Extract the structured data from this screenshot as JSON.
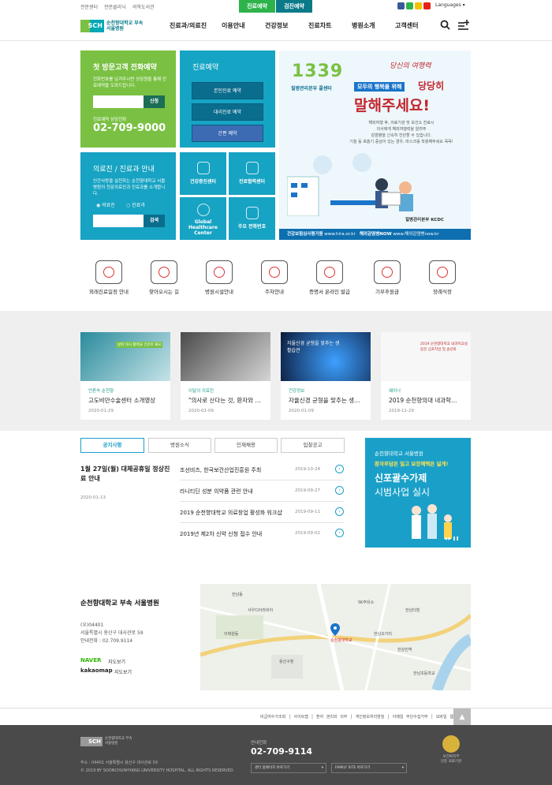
{
  "top_links": [
    "전문센터",
    "전문클리닉",
    "의학도서관"
  ],
  "top_buttons": {
    "reserve": "진료예약",
    "checkup": "검진예약"
  },
  "language": "Languages",
  "logo": {
    "mark": "SCH",
    "line1": "순천향대학교 부속",
    "line2": "서울병원"
  },
  "nav": [
    "진료과/의료진",
    "이용안내",
    "건강정보",
    "진료차트",
    "병원소개",
    "고객센터"
  ],
  "first_visit": {
    "title": "첫 방문고객 전화예약",
    "desc": "전화번호를 남겨주시면 상담원을 통해 진료예약을 도와드립니다.",
    "button": "신청",
    "phone_label": "진료예약 상담전화",
    "phone": "02-709-9000"
  },
  "reservation": {
    "title": "진료예약",
    "buttons": [
      "본인진료 예약",
      "대리진료 예약",
      "간편 예약"
    ]
  },
  "doctor_search": {
    "title": "의료진 / 진료과 안내",
    "desc": "인간사랑을 실천하는 순천향대학교 서울병원의 전문의료진과 진료과를 소개합니다.",
    "radio": [
      "의료진",
      "진료과"
    ],
    "button": "검색"
  },
  "grid_cells": [
    "건강증진센터",
    "진료협력센터",
    "Global Healthcare Center",
    "주요 전화번호"
  ],
  "banner": {
    "number": "1339",
    "script": "당신의 여행력",
    "line1": "모두의 행복을 위해",
    "line1b": "당당히",
    "line2": "질병관리본부 콜센터",
    "big": "말해주세요!",
    "desc1": "해외여행 후, 의료기관 및 보건소 진료시",
    "desc2": "의사에게 해외여행력을 알려주",
    "desc3": "감염병을 신속히 진단할 수 있습니다.",
    "desc4": "기침 등 호흡기 증상이 있는 경우, 마스크를 착용해주세요 꼭꼭!",
    "kcdc": "질병관리본부 KCDC",
    "footer1": "건강보험심사평가원",
    "footer1url": "www.hira.or.kr",
    "footer2": "해외감염병NOW",
    "footer2url": "www.해외감염병now.kr"
  },
  "quick_icons": [
    "외래진료일정 안내",
    "찾아오시는 길",
    "병원시설안내",
    "주차안내",
    "증명서 온라인 발급",
    "기부후원금",
    "장례식장"
  ],
  "cards": [
    {
      "category": "언론속 순천향",
      "title": "고도비만수술센터 소개영상",
      "date": "2020-01-29",
      "overlay": "삶의 대시 활력을 건강히 돼요"
    },
    {
      "category": "이달의 의료진",
      "title": "\"의사로 산다는 것, 환자와 …",
      "date": "2020-01-09"
    },
    {
      "category": "건강정보",
      "title": "자율신경 균형을 맞추는 생…",
      "date": "2020-01-09",
      "overlay": "자율신경 균형을 맞추는 생활습관"
    },
    {
      "category": "웨이나",
      "title": "2019 순천향의대 내과학…",
      "date": "2019-11-29",
      "overlay": "2019 순천향대학교 내과학교실 동문 심포지엄 및 송년회"
    }
  ],
  "notice_tabs": [
    "공지사항",
    "병원소식",
    "인재채용",
    "입찰공고"
  ],
  "feature_notice": {
    "title": "1월 27일(월) 대체공휴일 정상진료 안내",
    "date": "2020-01-13"
  },
  "notices": [
    {
      "title": "조선비즈, 한국보건산업진흥원 주최",
      "date": "2019-10-24"
    },
    {
      "title": "라니티딘 성분 의약품 관련 안내",
      "date": "2019-09-27"
    },
    {
      "title": "2019 순천향대학교 의료창업 활성화 워크샵",
      "date": "2019-09-11"
    },
    {
      "title": "2019년 제2차 신약 신청 접수 안내",
      "date": "2019-09-02"
    }
  ],
  "side_banner": {
    "line1": "순천향대학교 서울병원",
    "line2": "환자부담은 덜고 보장혜택은 넓게!",
    "line3": "신포괄수가제",
    "line4": "시범사업 실시"
  },
  "hospital": {
    "name": "순천향대학교 부속 서울병원",
    "zip": "(우)04401",
    "addr": "서울특별시 용산구 대사관로 59",
    "tel": "안내전화 : 02.709.9114",
    "naver": "NAVER",
    "naver_label": "지도보기",
    "kakao": "kakaomap",
    "kakao_label": "지도보기"
  },
  "map_labels": [
    "한남동",
    "SK주유소",
    "한남더힐",
    "이태원동",
    "용산구청",
    "한남오거리",
    "사우디아라비아",
    "한강진역",
    "순천향대학교",
    "한남초등학교"
  ],
  "footer_links": [
    "비급여수가조회",
    "사이트맵",
    "환자 권리와 의무",
    "개인정보처리방침",
    "이메일 무단수집거부",
    "모바일 웹"
  ],
  "footer": {
    "address": "주소 : 04401 서울특별시 용산구 대사관로 59",
    "copyright": "© 2019 BY SOONCHUNHYANG UNIVERSITY HOSPITAL. ALL RIGHTS RESERVED.",
    "tel_label": "안내전화",
    "tel": "02-709-9114",
    "select1": "센터 홈페이지 바로가기",
    "select2": "FAMILY SITE 바로가기",
    "cert1": "보건복지부",
    "cert2": "인증 의료기관",
    "logo_line1": "순천향대학교 부속",
    "logo_line2": "서울병원"
  }
}
